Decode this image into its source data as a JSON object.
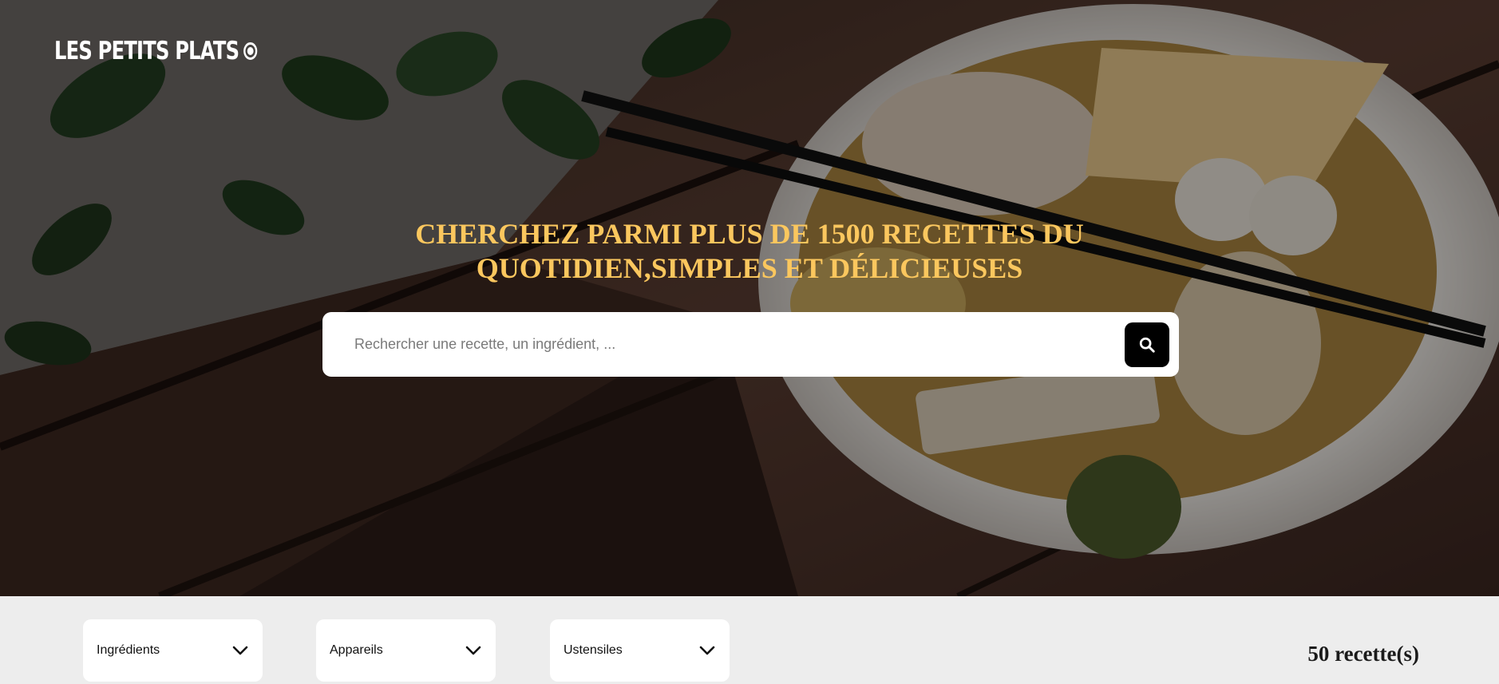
{
  "header": {
    "logo_text": "LES PETITS PLATS"
  },
  "hero": {
    "title_line_1": "CHERCHEZ PARMI PLUS DE 1500 RECETTES DU",
    "title_line_2": "QUOTIDIEN,SIMPLES ET DÉLICIEUSES",
    "title_color": "#fbc75e",
    "background_image": "noodle-bowl-with-chopsticks-on-wooden-table"
  },
  "search": {
    "value": "",
    "placeholder": "Rechercher une recette, un ingrédient, ...",
    "button_icon": "search-icon"
  },
  "filters": [
    {
      "label": "Ingrédients",
      "icon": "chevron-down-icon"
    },
    {
      "label": "Appareils",
      "icon": "chevron-down-icon"
    },
    {
      "label": "Ustensiles",
      "icon": "chevron-down-icon"
    }
  ],
  "results": {
    "count_text": "50 recette(s)"
  }
}
